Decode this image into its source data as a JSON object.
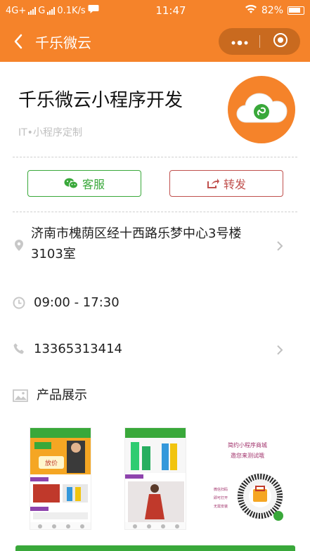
{
  "status_bar": {
    "network_left": "4G+",
    "network_mid": "G",
    "speed": "0.1K/s",
    "time": "11:47",
    "battery": "82%"
  },
  "nav": {
    "title": "千乐微云"
  },
  "shop": {
    "title": "千乐微云小程序开发",
    "tag": "IT•小程序定制"
  },
  "buttons": {
    "service_label": "客服",
    "share_label": "转发"
  },
  "info": {
    "address_line1": "济南市槐荫区经十西路乐梦中心3号楼",
    "address_line2": "3103室",
    "hours": "09:00 - 17:30",
    "phone": "13365313414"
  },
  "products": {
    "section_title": "产品展示",
    "thumb1_banner": "放价",
    "qr_line1": "简约小程序商城",
    "qr_line2": "邀您来测试哦",
    "qr_side1": "微信扫码",
    "qr_side2": "即可打开",
    "qr_side3": "无需安装"
  },
  "colors": {
    "brand": "#f5832a",
    "service": "#39a83a",
    "share": "#c0504d"
  }
}
